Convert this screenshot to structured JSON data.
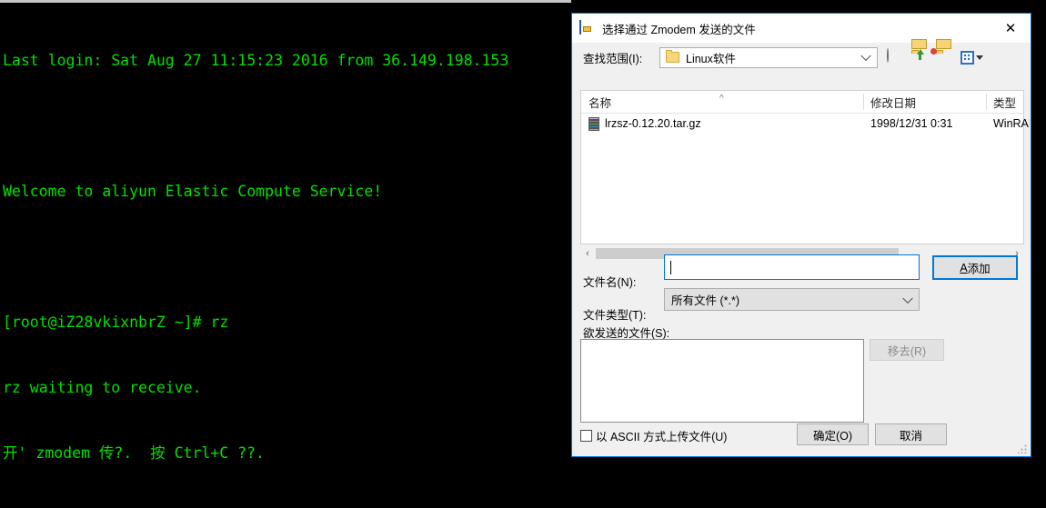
{
  "terminal": {
    "lines": [
      "Last login: Sat Aug 27 11:15:23 2016 from 36.149.198.153",
      "",
      "Welcome to aliyun Elastic Compute Service!",
      "",
      "[root@iZ28vkixnbrZ ~]# rz",
      "rz waiting to receive.",
      "开' zmodem 传?.  按 Ctrl+C ??."
    ],
    "text_color": "#00e000",
    "background": "#000000"
  },
  "dialog": {
    "title": "选择通过 Zmodem 发送的文件",
    "title_icon": "zmodem-window-icon",
    "close_label": "✕",
    "accent_color": "#0078d7",
    "lookin": {
      "label": "查找范围(I):",
      "value": "Linux软件",
      "folder_icon": "folder-icon",
      "chevron_icon": "chevron-down-icon"
    },
    "toolbar": [
      {
        "name": "back-icon",
        "label": "后退"
      },
      {
        "name": "up-folder-icon",
        "label": "向上一级"
      },
      {
        "name": "new-folder-icon",
        "label": "新建文件夹"
      },
      {
        "name": "views-icon",
        "label": "视图"
      }
    ],
    "filelist": {
      "columns": [
        "名称",
        "修改日期",
        "类型"
      ],
      "sort_caret": "^",
      "rows": [
        {
          "icon": "winrar-archive-icon",
          "name": "lrzsz-0.12.20.tar.gz",
          "modified": "1998/12/31 0:31",
          "type": "WinRAR"
        }
      ]
    },
    "hscroll": {
      "left_arrow": "‹",
      "right_arrow": "›"
    },
    "filename": {
      "label": "文件名(N):",
      "value": "",
      "placeholder": ""
    },
    "add_button": {
      "accel": "A",
      "label": "添加"
    },
    "filetype": {
      "label": "文件类型(T):",
      "value": "所有文件 (*.*)",
      "chevron_icon": "chevron-down-icon"
    },
    "sendlist": {
      "label": "欲发送的文件(S):",
      "items": []
    },
    "remove_button": {
      "label": "移去(R)",
      "disabled": true
    },
    "ascii_checkbox": {
      "label": "以 ASCII 方式上传文件(U)",
      "checked": false
    },
    "ok_button": {
      "label": "确定(O)"
    },
    "cancel_button": {
      "label": "取消"
    }
  }
}
